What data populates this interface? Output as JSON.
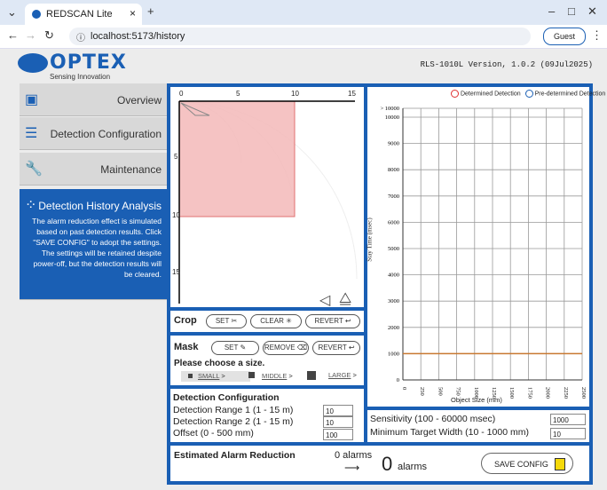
{
  "browser": {
    "tab_title": "REDSCAN Lite",
    "url": "localhost:5173/history",
    "profile_label": "Guest"
  },
  "header": {
    "logo_text": "OPTEX",
    "logo_subtitle": "Sensing Innovation",
    "version": "RLS-1010L Version, 1.0.2 (09Jul2025)"
  },
  "sidebar": {
    "items": [
      {
        "label": "Overview"
      },
      {
        "label": "Detection Configuration"
      },
      {
        "label": "Maintenance"
      },
      {
        "label": "Detection History Analysis",
        "description": "The alarm reduction effect is simulated based on past detection results. Click \"SAVE CONFIG\" to adopt the settings. The settings will be retained despite power-off, but the detection results will be cleared."
      }
    ]
  },
  "map": {
    "top_ticks": [
      "0",
      "5",
      "10",
      "15"
    ],
    "left_ticks": [
      "5",
      "10",
      "15"
    ]
  },
  "crop": {
    "title": "Crop",
    "set_label": "SET",
    "clear_label": "CLEAR",
    "revert_label": "REVERT"
  },
  "mask": {
    "title": "Mask",
    "set_label": "SET",
    "remove_label": "REMOVE",
    "revert_label": "REVERT",
    "prompt": "Please choose a size.",
    "sizes": [
      "SMALL",
      "MIDDLE",
      "LARGE"
    ]
  },
  "detection_config": {
    "title": "Detection Configuration",
    "range1_label": "Detection Range 1 (1 - 15 m)",
    "range1_value": "10",
    "range2_label": "Detection Range 2 (1 - 15 m)",
    "range2_value": "10",
    "offset_label": "Offset (0 - 500 mm)",
    "offset_value": "100"
  },
  "sensitivity": {
    "sensitivity_label": "Sensitivity (100 - 60000 msec)",
    "sensitivity_value": "1000",
    "min_width_label": "Minimum Target Width (10 - 1000 mm)",
    "min_width_value": "10"
  },
  "estimate": {
    "title": "Estimated Alarm Reduction",
    "before_label": "0 alarms",
    "after_count": "0",
    "after_unit": "alarms",
    "save_label": "SAVE CONFIG"
  },
  "chart_data": {
    "type": "scatter",
    "legend": [
      "Determined Detection",
      "Pre-determined Detection"
    ],
    "legend_colors": [
      "#e03030",
      "#1a5fb4"
    ],
    "xlabel": "Object Size (mm)",
    "ylabel": "Stay Time (msec)",
    "x_ticks": [
      "0",
      "250",
      "500",
      "750",
      "1000",
      "1250",
      "1500",
      "1750",
      "2000",
      "2250",
      "2500"
    ],
    "y_ticks": [
      "0",
      "1000",
      "2000",
      "3000",
      "4000",
      "5000",
      "6000",
      "7000",
      "8000",
      "9000",
      "10000",
      "> 10000"
    ],
    "xlim": [
      0,
      2500
    ],
    "ylim": [
      0,
      10000
    ],
    "threshold_y": 1000,
    "threshold_color": "#c87830",
    "series": []
  }
}
